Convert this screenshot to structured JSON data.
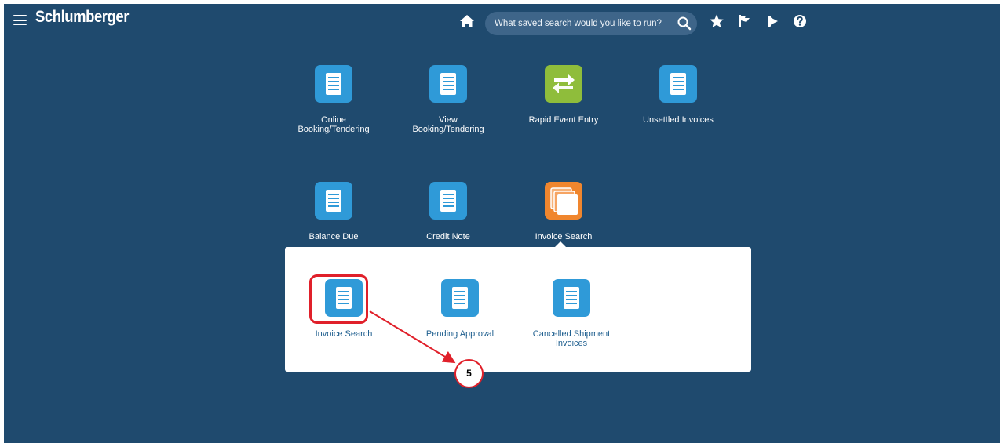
{
  "header": {
    "logo": "Schlumberger",
    "search_placeholder": "What saved search would you like to run?",
    "icons": [
      "hamburger-icon",
      "home-icon",
      "search-icon",
      "star-icon",
      "flag-icon",
      "bell-icon",
      "help-icon"
    ]
  },
  "tiles": [
    {
      "label": "Online\nBooking/Tendering",
      "icon": "document-icon",
      "color": "#2f9ad8"
    },
    {
      "label": "View\nBooking/Tendering",
      "icon": "document-icon",
      "color": "#2f9ad8"
    },
    {
      "label": "Rapid Event Entry",
      "icon": "transfer-icon",
      "color": "#8fbd3b"
    },
    {
      "label": "Unsettled Invoices",
      "icon": "document-icon",
      "color": "#2f9ad8"
    },
    {
      "label": "Balance Due",
      "icon": "document-icon",
      "color": "#2f9ad8"
    },
    {
      "label": "Credit Note",
      "icon": "document-icon",
      "color": "#2f9ad8"
    },
    {
      "label": "Invoice Search",
      "icon": "stack-icon",
      "color": "#f0862e"
    }
  ],
  "submenu": [
    {
      "label": "Invoice Search",
      "icon": "document-icon"
    },
    {
      "label": "Pending Approval",
      "icon": "document-icon"
    },
    {
      "label": "Cancelled Shipment\nInvoices",
      "icon": "document-icon"
    }
  ],
  "annotation": {
    "step": "5",
    "color": "#e0202a"
  },
  "colors": {
    "background": "#1f4a6e",
    "search_bg": "#3e6589",
    "submenu_text": "#1f5f8f"
  }
}
